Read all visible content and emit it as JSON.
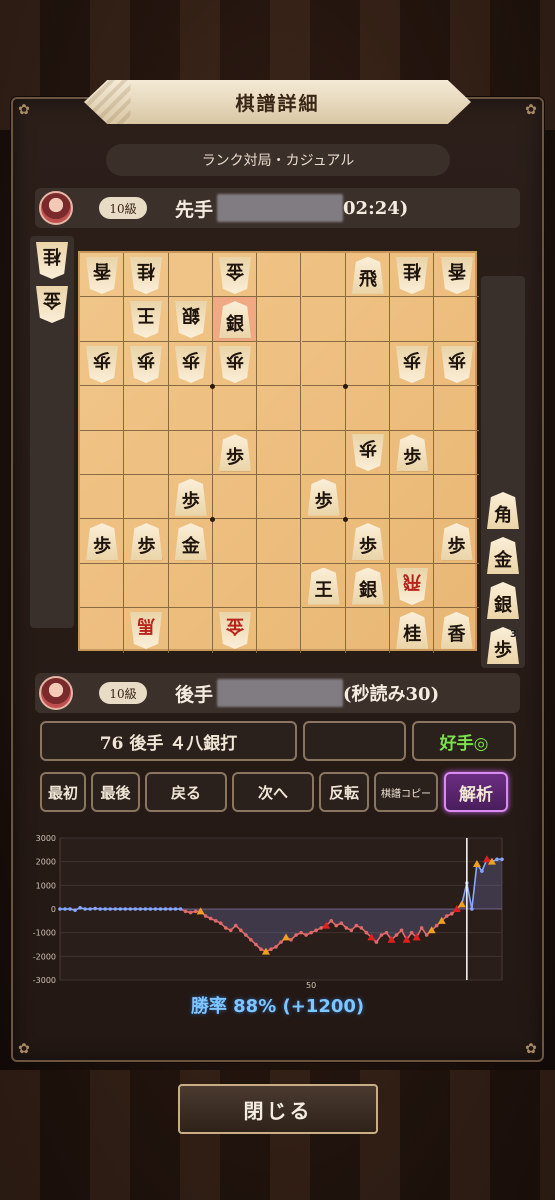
{
  "header": {
    "title": "棋譜詳細",
    "subtitle": "ランク対局・カジュアル"
  },
  "sente": {
    "rank": "10級",
    "side": "先手",
    "time": "02:24)"
  },
  "gote": {
    "rank": "10級",
    "side": "後手",
    "time": "(秒読み30)"
  },
  "board": {
    "highlight": [
      4,
      2
    ],
    "pieces": [
      {
        "c": 1,
        "r": 1,
        "k": "香",
        "g": true
      },
      {
        "c": 2,
        "r": 1,
        "k": "桂",
        "g": true
      },
      {
        "c": 4,
        "r": 1,
        "k": "金",
        "g": true
      },
      {
        "c": 7,
        "r": 1,
        "k": "飛",
        "g": false
      },
      {
        "c": 8,
        "r": 1,
        "k": "桂",
        "g": true
      },
      {
        "c": 9,
        "r": 1,
        "k": "香",
        "g": true
      },
      {
        "c": 2,
        "r": 2,
        "k": "王",
        "g": true
      },
      {
        "c": 3,
        "r": 2,
        "k": "銀",
        "g": true
      },
      {
        "c": 4,
        "r": 2,
        "k": "銀",
        "g": false
      },
      {
        "c": 1,
        "r": 3,
        "k": "歩",
        "g": true
      },
      {
        "c": 2,
        "r": 3,
        "k": "歩",
        "g": true
      },
      {
        "c": 3,
        "r": 3,
        "k": "歩",
        "g": true
      },
      {
        "c": 4,
        "r": 3,
        "k": "歩",
        "g": true
      },
      {
        "c": 8,
        "r": 3,
        "k": "歩",
        "g": true
      },
      {
        "c": 9,
        "r": 3,
        "k": "歩",
        "g": true
      },
      {
        "c": 4,
        "r": 5,
        "k": "歩",
        "g": false
      },
      {
        "c": 7,
        "r": 5,
        "k": "歩",
        "g": true
      },
      {
        "c": 8,
        "r": 5,
        "k": "歩",
        "g": false
      },
      {
        "c": 3,
        "r": 6,
        "k": "歩",
        "g": false
      },
      {
        "c": 6,
        "r": 6,
        "k": "歩",
        "g": false
      },
      {
        "c": 1,
        "r": 7,
        "k": "歩",
        "g": false
      },
      {
        "c": 2,
        "r": 7,
        "k": "歩",
        "g": false
      },
      {
        "c": 3,
        "r": 7,
        "k": "金",
        "g": false
      },
      {
        "c": 7,
        "r": 7,
        "k": "歩",
        "g": false
      },
      {
        "c": 9,
        "r": 7,
        "k": "歩",
        "g": false
      },
      {
        "c": 6,
        "r": 8,
        "k": "王",
        "g": false
      },
      {
        "c": 7,
        "r": 8,
        "k": "銀",
        "g": false
      },
      {
        "c": 8,
        "r": 8,
        "k": "飛",
        "g": true,
        "red": true
      },
      {
        "c": 2,
        "r": 9,
        "k": "馬",
        "g": true,
        "red": true
      },
      {
        "c": 4,
        "r": 9,
        "k": "金",
        "g": true,
        "red": true
      },
      {
        "c": 8,
        "r": 9,
        "k": "桂",
        "g": false
      },
      {
        "c": 9,
        "r": 9,
        "k": "香",
        "g": false
      }
    ]
  },
  "hands": {
    "gote": [
      {
        "k": "桂"
      },
      {
        "k": "金"
      }
    ],
    "sente": [
      {
        "k": "角"
      },
      {
        "k": "金"
      },
      {
        "k": "銀"
      },
      {
        "k": "歩",
        "n": "3"
      }
    ]
  },
  "move": {
    "text": "76 後手 ４八銀打",
    "empty": "",
    "eval": "好手◎"
  },
  "buttons": {
    "first": "最初",
    "last": "最後",
    "back": "戻る",
    "next": "次へ",
    "flip": "反転",
    "copy": "棋譜コピー",
    "analyze": "解析"
  },
  "graph": {
    "y_ticks": [
      "3000",
      "2000",
      "1000",
      "0",
      "-1000",
      "-2000",
      "-3000"
    ],
    "x_tick": "50",
    "ylim": [
      -3000,
      3000
    ],
    "n_moves": 88,
    "cursor_move": 76,
    "points": [
      0,
      0,
      0,
      -50,
      50,
      0,
      0,
      20,
      0,
      0,
      0,
      0,
      0,
      0,
      0,
      0,
      0,
      0,
      0,
      0,
      0,
      0,
      0,
      0,
      0,
      -100,
      -150,
      -100,
      -100,
      -300,
      -400,
      -500,
      -600,
      -800,
      -900,
      -700,
      -900,
      -1100,
      -1300,
      -1500,
      -1700,
      -1800,
      -1700,
      -1600,
      -1400,
      -1200,
      -1300,
      -1100,
      -1000,
      -1100,
      -1000,
      -900,
      -800,
      -700,
      -500,
      -700,
      -600,
      -800,
      -900,
      -700,
      -800,
      -1000,
      -1200,
      -1400,
      -1100,
      -1000,
      -1300,
      -1100,
      -900,
      -1300,
      -1000,
      -1200,
      -800,
      -1100,
      -900,
      -700,
      -500,
      -300,
      -200,
      0,
      200,
      1100,
      0,
      1900,
      1600,
      2100,
      2000,
      2100,
      2100
    ],
    "line_color": "#e06a6a",
    "pos_line_color": "#86a8ff"
  },
  "winrate": "勝率 88% (+1200)",
  "close": "閉じる"
}
